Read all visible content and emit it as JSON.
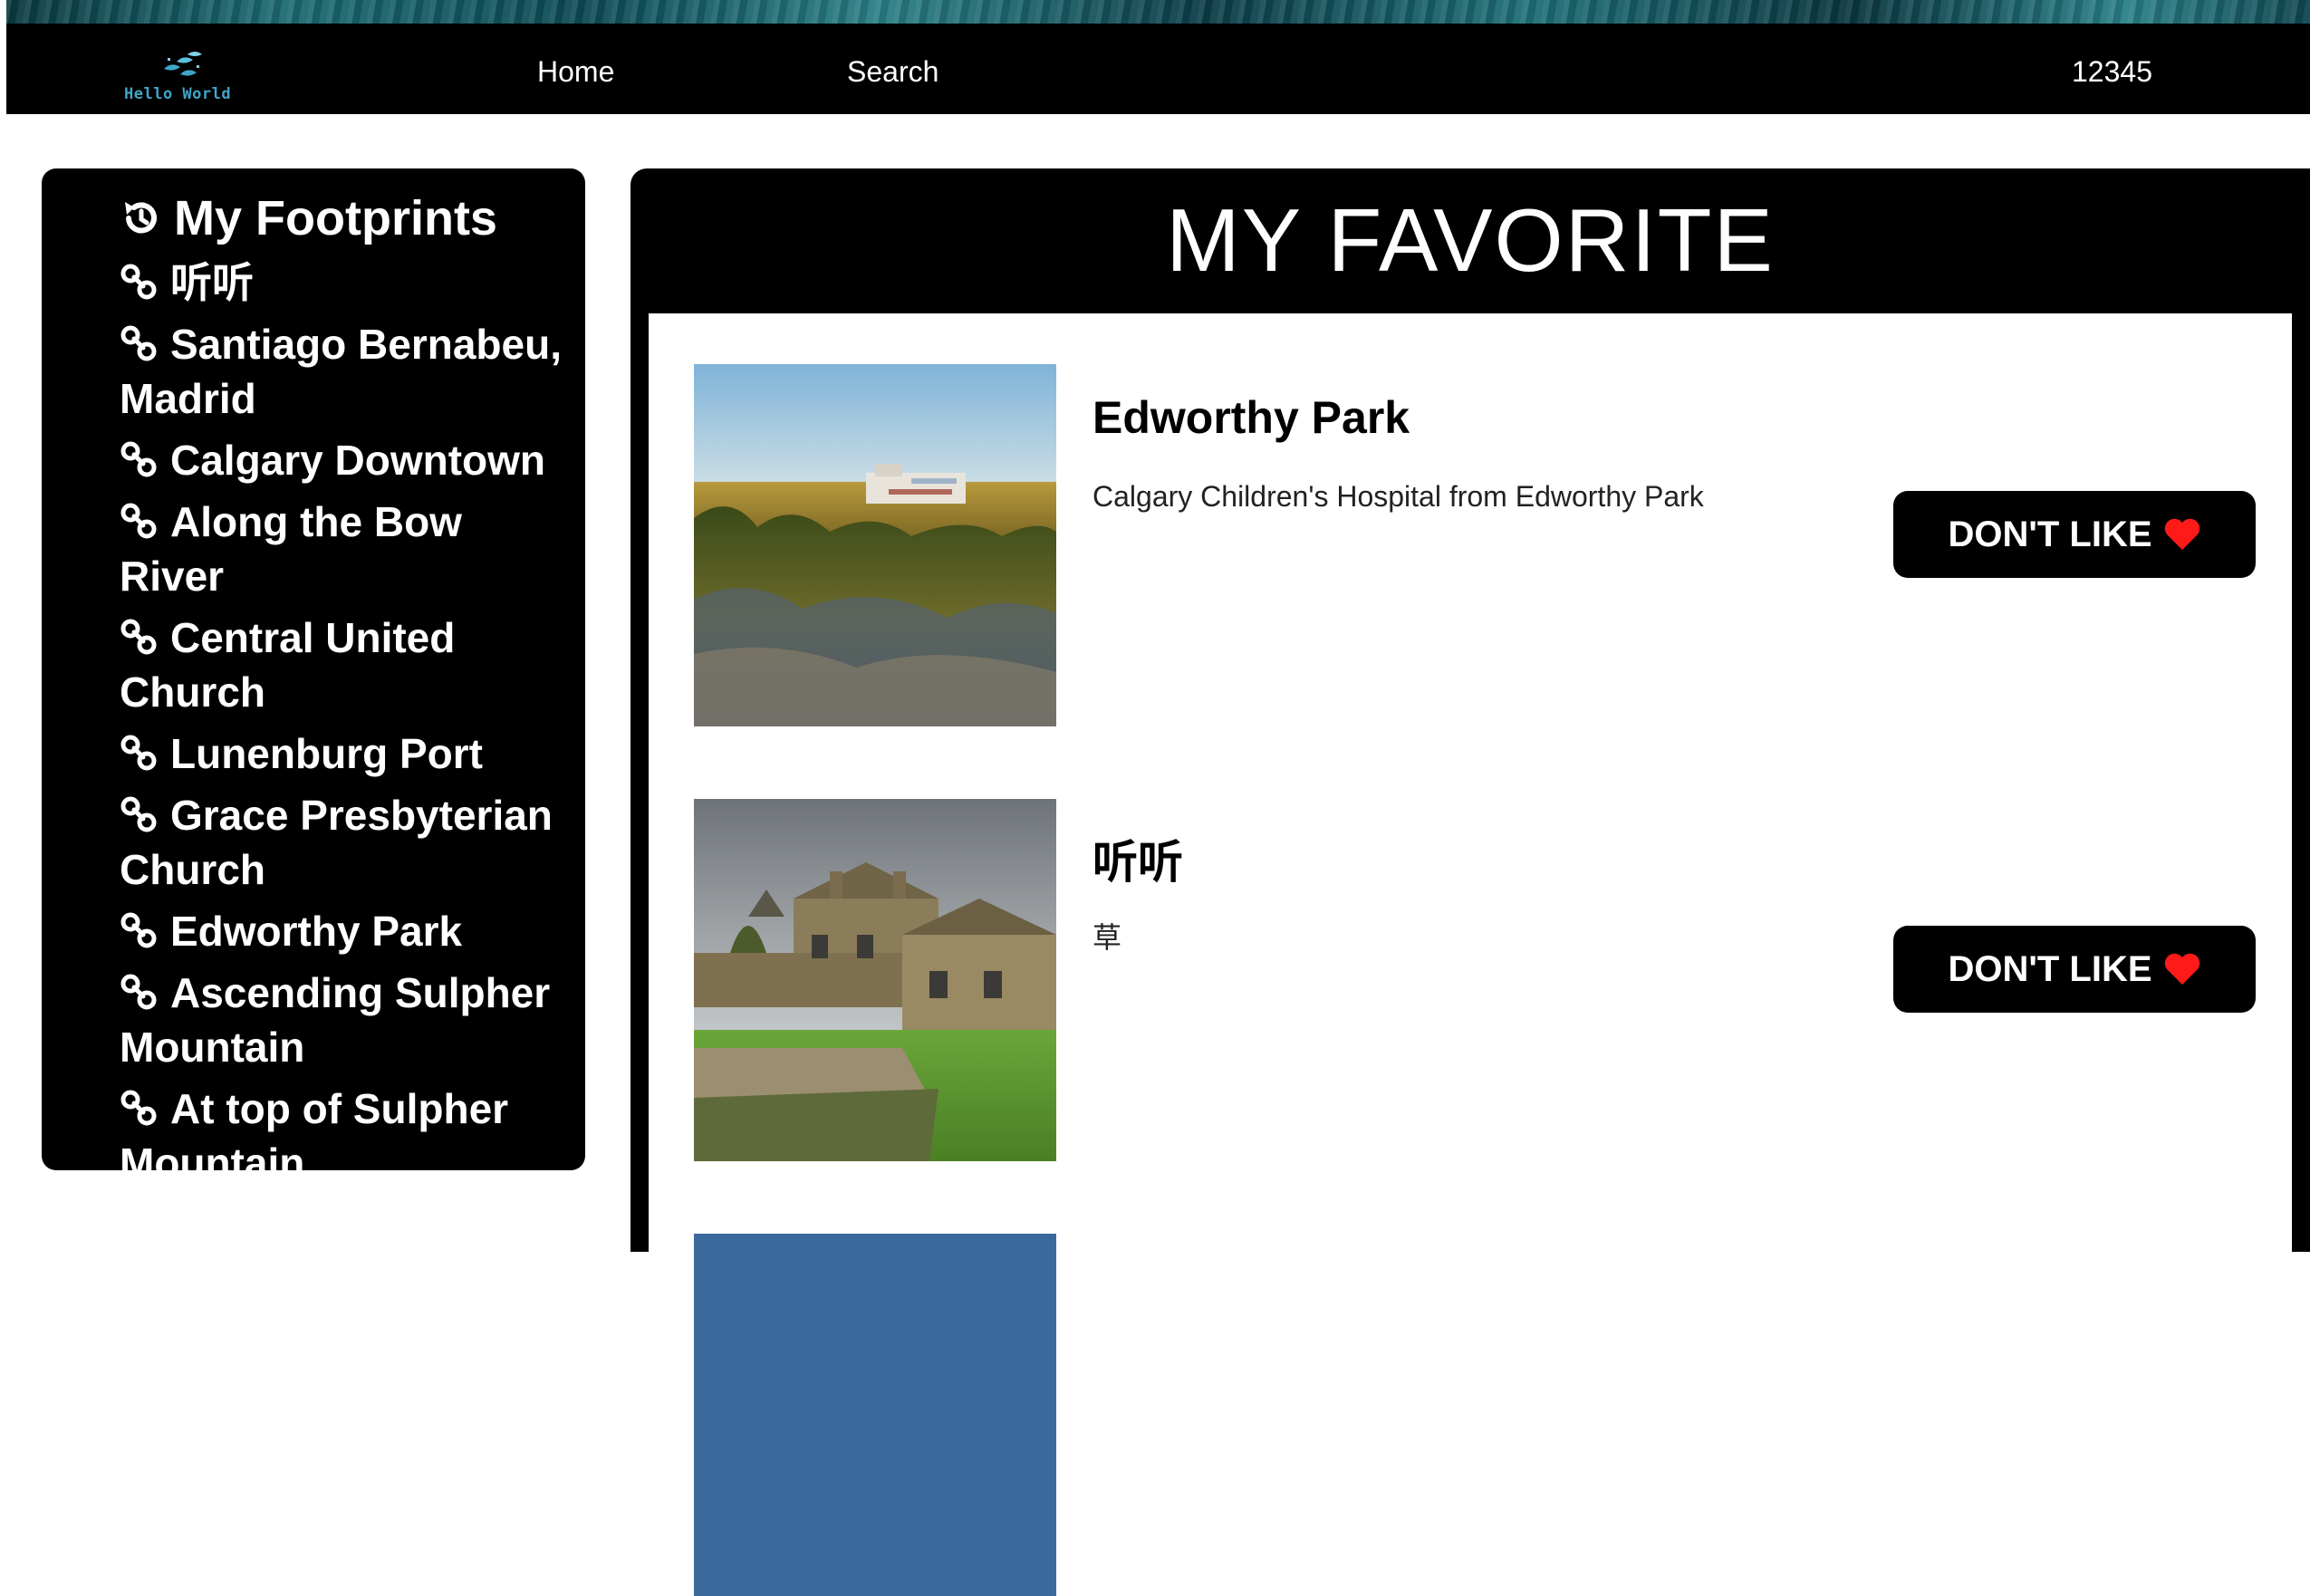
{
  "header": {
    "logo_text": "Hello World",
    "nav": {
      "home": "Home",
      "search": "Search",
      "user": "12345"
    }
  },
  "sidebar": {
    "title": "My Footprints",
    "title_icon": "history-icon",
    "item_icon": "link-icon",
    "items": [
      {
        "label": "听听"
      },
      {
        "label": "Santiago Bernabeu, Madrid"
      },
      {
        "label": "Calgary Downtown"
      },
      {
        "label": "Along the Bow River"
      },
      {
        "label": "Central United Church"
      },
      {
        "label": "Lunenburg Port"
      },
      {
        "label": "Grace Presbyterian Church"
      },
      {
        "label": "Edworthy Park"
      },
      {
        "label": "Ascending Sulpher Mountain"
      },
      {
        "label": "At top of Sulpher Mountain"
      }
    ]
  },
  "main": {
    "title": "MY FAVORITE",
    "favorites": [
      {
        "name": "Edworthy Park",
        "description": "Calgary Children's Hospital from Edworthy Park",
        "button": "DON'T LIKE"
      },
      {
        "name": "听听",
        "description": "草",
        "button": "DON'T LIKE"
      }
    ]
  },
  "colors": {
    "background": "#ffffff",
    "panel": "#000000",
    "heart": "#ff1a1a",
    "logo_accent": "#3fa6c8"
  }
}
